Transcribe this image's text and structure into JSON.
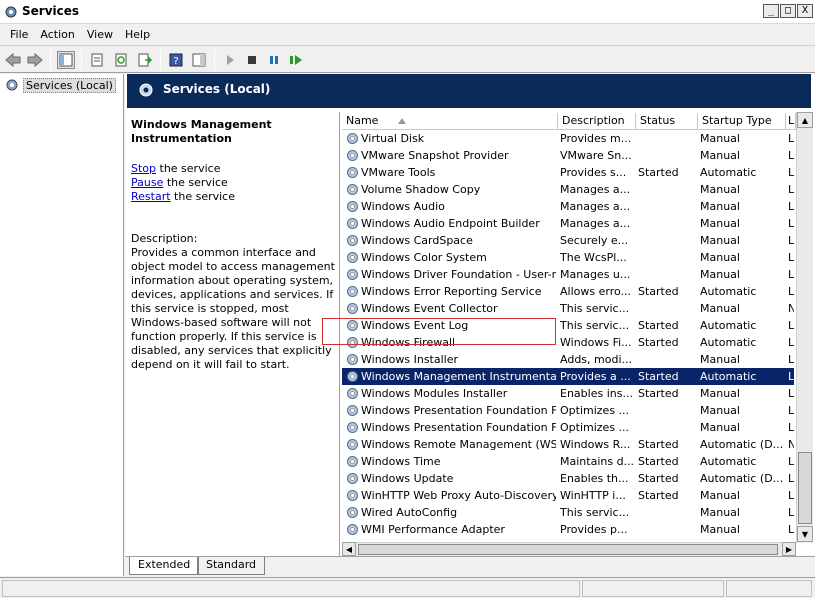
{
  "window": {
    "title": "Services",
    "min": "_",
    "max": "□",
    "close": "X"
  },
  "menu": [
    "File",
    "Action",
    "View",
    "Help"
  ],
  "tree": {
    "root": "Services (Local)"
  },
  "header": {
    "title": "Services (Local)"
  },
  "details": {
    "title": "Windows Management Instrumentation",
    "actions": [
      {
        "link": "Stop",
        "rest": " the service"
      },
      {
        "link": "Pause",
        "rest": " the service"
      },
      {
        "link": "Restart",
        "rest": " the service"
      }
    ],
    "desc_label": "Description:",
    "desc": "Provides a common interface and object model to access management information about operating system, devices, applications and services. If this service is stopped, most Windows-based software will not function properly. If this service is disabled, any services that explicitly depend on it will fail to start."
  },
  "columns": [
    "Name",
    "Description",
    "Status",
    "Startup Type",
    "L"
  ],
  "rows": [
    {
      "name": "Virtual Disk",
      "desc": "Provides m...",
      "status": "",
      "startup": "Manual",
      "logon": "L"
    },
    {
      "name": "VMware Snapshot Provider",
      "desc": "VMware Sn...",
      "status": "",
      "startup": "Manual",
      "logon": "L"
    },
    {
      "name": "VMware Tools",
      "desc": "Provides s...",
      "status": "Started",
      "startup": "Automatic",
      "logon": "L"
    },
    {
      "name": "Volume Shadow Copy",
      "desc": "Manages a...",
      "status": "",
      "startup": "Manual",
      "logon": "L"
    },
    {
      "name": "Windows Audio",
      "desc": "Manages a...",
      "status": "",
      "startup": "Manual",
      "logon": "L"
    },
    {
      "name": "Windows Audio Endpoint Builder",
      "desc": "Manages a...",
      "status": "",
      "startup": "Manual",
      "logon": "L"
    },
    {
      "name": "Windows CardSpace",
      "desc": "Securely e...",
      "status": "",
      "startup": "Manual",
      "logon": "L"
    },
    {
      "name": "Windows Color System",
      "desc": "The WcsPl...",
      "status": "",
      "startup": "Manual",
      "logon": "L"
    },
    {
      "name": "Windows Driver Foundation - User-m...",
      "desc": "Manages u...",
      "status": "",
      "startup": "Manual",
      "logon": "L"
    },
    {
      "name": "Windows Error Reporting Service",
      "desc": "Allows erro...",
      "status": "Started",
      "startup": "Automatic",
      "logon": "L"
    },
    {
      "name": "Windows Event Collector",
      "desc": "This servic...",
      "status": "",
      "startup": "Manual",
      "logon": "N"
    },
    {
      "name": "Windows Event Log",
      "desc": "This servic...",
      "status": "Started",
      "startup": "Automatic",
      "logon": "L"
    },
    {
      "name": "Windows Firewall",
      "desc": "Windows Fi...",
      "status": "Started",
      "startup": "Automatic",
      "logon": "L"
    },
    {
      "name": "Windows Installer",
      "desc": "Adds, modi...",
      "status": "",
      "startup": "Manual",
      "logon": "L"
    },
    {
      "name": "Windows Management Instrumentation",
      "desc": "Provides a ...",
      "status": "Started",
      "startup": "Automatic",
      "logon": "L",
      "selected": true
    },
    {
      "name": "Windows Modules Installer",
      "desc": "Enables ins...",
      "status": "Started",
      "startup": "Manual",
      "logon": "L"
    },
    {
      "name": "Windows Presentation Foundation Fo...",
      "desc": "Optimizes ...",
      "status": "",
      "startup": "Manual",
      "logon": "L"
    },
    {
      "name": "Windows Presentation Foundation Fo...",
      "desc": "Optimizes ...",
      "status": "",
      "startup": "Manual",
      "logon": "L"
    },
    {
      "name": "Windows Remote Management (WS-...",
      "desc": "Windows R...",
      "status": "Started",
      "startup": "Automatic (D...",
      "logon": "N"
    },
    {
      "name": "Windows Time",
      "desc": "Maintains d...",
      "status": "Started",
      "startup": "Automatic",
      "logon": "L"
    },
    {
      "name": "Windows Update",
      "desc": "Enables th...",
      "status": "Started",
      "startup": "Automatic (D...",
      "logon": "L"
    },
    {
      "name": "WinHTTP Web Proxy Auto-Discovery ...",
      "desc": "WinHTTP i...",
      "status": "Started",
      "startup": "Manual",
      "logon": "L"
    },
    {
      "name": "Wired AutoConfig",
      "desc": "This servic...",
      "status": "",
      "startup": "Manual",
      "logon": "L"
    },
    {
      "name": "WMI Performance Adapter",
      "desc": "Provides p...",
      "status": "",
      "startup": "Manual",
      "logon": "L"
    }
  ],
  "tabs": [
    "Extended",
    "Standard"
  ],
  "colors": {
    "header_band": "#0a2a5a",
    "selection": "#0a246a",
    "link": "#0000cc"
  }
}
